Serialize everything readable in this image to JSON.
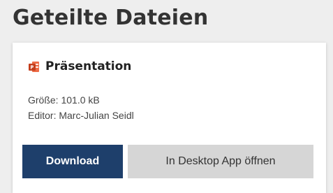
{
  "page": {
    "title": "Geteilte Dateien"
  },
  "file": {
    "icon": "powerpoint-file-icon",
    "name": "Präsentation",
    "size_text": "Größe: 101.0 kB",
    "editor_text": "Editor: Marc-Julian Seidl"
  },
  "actions": {
    "download_label": "Download",
    "open_desktop_label": "In Desktop App öffnen"
  },
  "colors": {
    "primary_button": "#1e3f6b",
    "secondary_button": "#d6d6d6",
    "powerpoint_orange": "#d24726"
  }
}
